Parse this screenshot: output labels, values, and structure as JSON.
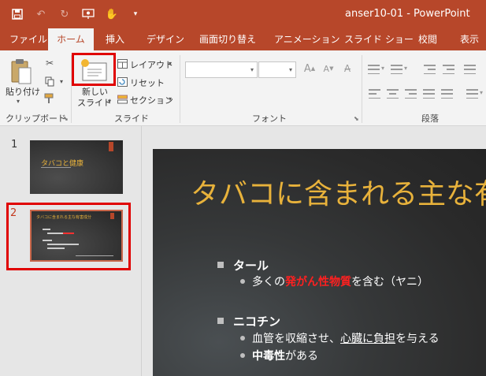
{
  "window": {
    "doc_title": "anser10-01 - PowerPoint"
  },
  "qat": {
    "icons": [
      "save-icon",
      "undo-icon",
      "redo-icon",
      "present-icon",
      "touch-mode-icon",
      "customize-qat-icon"
    ]
  },
  "tabs": [
    {
      "label": "ファイル"
    },
    {
      "label": "ホーム"
    },
    {
      "label": "挿入"
    },
    {
      "label": "デザイン"
    },
    {
      "label": "画面切り替え"
    },
    {
      "label": "アニメーション"
    },
    {
      "label": "スライド ショー"
    },
    {
      "label": "校閲"
    },
    {
      "label": "表示"
    }
  ],
  "ribbon": {
    "clipboard": {
      "paste_label": "貼り付け",
      "group_label": "クリップボード"
    },
    "slides": {
      "new_slide_line1": "新しい",
      "new_slide_line2": "スライド",
      "layout_label": "レイアウト",
      "reset_label": "リセット",
      "section_label": "セクション",
      "group_label": "スライド"
    },
    "font": {
      "group_label": "フォント",
      "font_name": "",
      "font_size": ""
    },
    "paragraph": {
      "group_label": "段落"
    }
  },
  "thumbnails": [
    {
      "number": "1",
      "title": "タバコと健康"
    },
    {
      "number": "2",
      "title": "タバコに含まれる主な有害成分"
    }
  ],
  "slide": {
    "title": "タバコに含まれる主な有害成分",
    "bullets": [
      {
        "text": "タール",
        "sub": [
          {
            "pre": "多くの",
            "red": "発がん性物質",
            "post": "を含む（ヤニ）"
          }
        ]
      },
      {
        "text": "ニコチン",
        "sub": [
          {
            "pre": "血管を収縮させ、",
            "ul": "心臓に負担",
            "post": "を与える"
          },
          {
            "bold": "中毒性",
            "post": "がある"
          }
        ]
      }
    ]
  },
  "colors": {
    "accent": "#b7472a",
    "title_gold": "#e8b23b",
    "highlight_red": "#e00000"
  }
}
